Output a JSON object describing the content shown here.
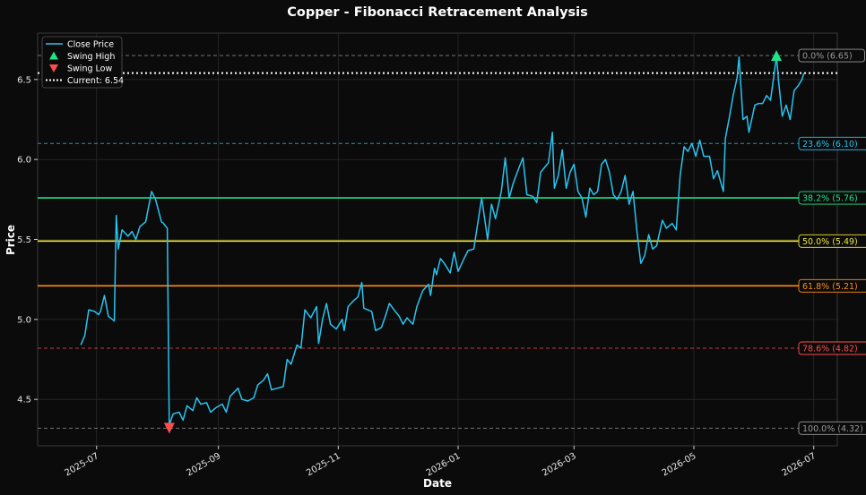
{
  "chart_data": {
    "type": "line",
    "title": "Copper - Fibonacci Retracement Analysis",
    "xlabel": "Date",
    "ylabel": "Price",
    "xlim": [
      "2025-06-01",
      "2026-07-13"
    ],
    "ylim": [
      4.21,
      6.79
    ],
    "x_ticks": [
      "2025-07",
      "2025-09",
      "2025-11",
      "2026-01",
      "2026-03",
      "2026-05",
      "2026-07"
    ],
    "y_ticks": [
      "4.5",
      "5.0",
      "5.5",
      "6.0",
      "6.5"
    ],
    "grid": true,
    "legend_position": "top-left",
    "legend": [
      {
        "label": "Close Price",
        "kind": "line",
        "color": "#29c4f0"
      },
      {
        "label": "Swing High",
        "kind": "triangle-up",
        "color": "#1fe28a"
      },
      {
        "label": "Swing Low",
        "kind": "triangle-down",
        "color": "#ff4d4d"
      },
      {
        "label": "Current: 6.54",
        "kind": "dotted",
        "color": "#ffffff"
      }
    ],
    "series": [
      {
        "name": "Close Price",
        "color": "#29c4f0",
        "points": [
          [
            "2025-06-23",
            4.84
          ],
          [
            "2025-06-25",
            4.9
          ],
          [
            "2025-06-27",
            5.06
          ],
          [
            "2025-06-30",
            5.05
          ],
          [
            "2025-07-02",
            5.03
          ],
          [
            "2025-07-03",
            5.05
          ],
          [
            "2025-07-05",
            5.15
          ],
          [
            "2025-07-07",
            5.02
          ],
          [
            "2025-07-10",
            4.99
          ],
          [
            "2025-07-11",
            5.65
          ],
          [
            "2025-07-12",
            5.44
          ],
          [
            "2025-07-14",
            5.56
          ],
          [
            "2025-07-17",
            5.52
          ],
          [
            "2025-07-19",
            5.55
          ],
          [
            "2025-07-21",
            5.5
          ],
          [
            "2025-07-23",
            5.58
          ],
          [
            "2025-07-26",
            5.61
          ],
          [
            "2025-07-29",
            5.8
          ],
          [
            "2025-07-31",
            5.75
          ],
          [
            "2025-08-03",
            5.61
          ],
          [
            "2025-08-04",
            5.6
          ],
          [
            "2025-08-06",
            5.57
          ],
          [
            "2025-08-07",
            4.34
          ],
          [
            "2025-08-09",
            4.41
          ],
          [
            "2025-08-12",
            4.42
          ],
          [
            "2025-08-14",
            4.37
          ],
          [
            "2025-08-16",
            4.46
          ],
          [
            "2025-08-19",
            4.43
          ],
          [
            "2025-08-21",
            4.51
          ],
          [
            "2025-08-23",
            4.47
          ],
          [
            "2025-08-26",
            4.48
          ],
          [
            "2025-08-28",
            4.42
          ],
          [
            "2025-08-31",
            4.45
          ],
          [
            "2025-09-03",
            4.47
          ],
          [
            "2025-09-05",
            4.42
          ],
          [
            "2025-09-07",
            4.52
          ],
          [
            "2025-09-11",
            4.57
          ],
          [
            "2025-09-13",
            4.5
          ],
          [
            "2025-09-16",
            4.49
          ],
          [
            "2025-09-19",
            4.51
          ],
          [
            "2025-09-21",
            4.59
          ],
          [
            "2025-09-24",
            4.62
          ],
          [
            "2025-09-26",
            4.66
          ],
          [
            "2025-09-28",
            4.56
          ],
          [
            "2025-10-01",
            4.57
          ],
          [
            "2025-10-04",
            4.58
          ],
          [
            "2025-10-06",
            4.75
          ],
          [
            "2025-10-08",
            4.72
          ],
          [
            "2025-10-11",
            4.84
          ],
          [
            "2025-10-13",
            4.82
          ],
          [
            "2025-10-15",
            5.06
          ],
          [
            "2025-10-18",
            5.01
          ],
          [
            "2025-10-21",
            5.08
          ],
          [
            "2025-10-22",
            4.85
          ],
          [
            "2025-10-24",
            5.0
          ],
          [
            "2025-10-26",
            5.1
          ],
          [
            "2025-10-28",
            4.97
          ],
          [
            "2025-10-31",
            4.94
          ],
          [
            "2025-11-03",
            5.0
          ],
          [
            "2025-11-04",
            4.93
          ],
          [
            "2025-11-06",
            5.08
          ],
          [
            "2025-11-09",
            5.12
          ],
          [
            "2025-11-11",
            5.14
          ],
          [
            "2025-11-13",
            5.23
          ],
          [
            "2025-11-14",
            5.07
          ],
          [
            "2025-11-18",
            5.05
          ],
          [
            "2025-11-20",
            4.93
          ],
          [
            "2025-11-23",
            4.95
          ],
          [
            "2025-11-25",
            5.02
          ],
          [
            "2025-11-27",
            5.1
          ],
          [
            "2025-11-30",
            5.05
          ],
          [
            "2025-12-02",
            5.02
          ],
          [
            "2025-12-04",
            4.97
          ],
          [
            "2025-12-06",
            5.01
          ],
          [
            "2025-12-09",
            4.97
          ],
          [
            "2025-12-11",
            5.08
          ],
          [
            "2025-12-14",
            5.18
          ],
          [
            "2025-12-17",
            5.22
          ],
          [
            "2025-12-18",
            5.15
          ],
          [
            "2025-12-20",
            5.32
          ],
          [
            "2025-12-21",
            5.28
          ],
          [
            "2025-12-23",
            5.38
          ],
          [
            "2025-12-25",
            5.35
          ],
          [
            "2025-12-28",
            5.29
          ],
          [
            "2025-12-30",
            5.42
          ],
          [
            "2026-01-01",
            5.3
          ],
          [
            "2026-01-04",
            5.38
          ],
          [
            "2026-01-06",
            5.43
          ],
          [
            "2026-01-09",
            5.44
          ],
          [
            "2026-01-11",
            5.6
          ],
          [
            "2026-01-13",
            5.76
          ],
          [
            "2026-01-16",
            5.5
          ],
          [
            "2026-01-18",
            5.72
          ],
          [
            "2026-01-20",
            5.63
          ],
          [
            "2026-01-23",
            5.8
          ],
          [
            "2026-01-25",
            6.01
          ],
          [
            "2026-01-27",
            5.76
          ],
          [
            "2026-01-29",
            5.85
          ],
          [
            "2026-02-01",
            5.95
          ],
          [
            "2026-02-03",
            6.01
          ],
          [
            "2026-02-05",
            5.78
          ],
          [
            "2026-02-08",
            5.77
          ],
          [
            "2026-02-10",
            5.73
          ],
          [
            "2026-02-12",
            5.92
          ],
          [
            "2026-02-14",
            5.95
          ],
          [
            "2026-02-16",
            5.98
          ],
          [
            "2026-02-18",
            6.17
          ],
          [
            "2026-02-19",
            5.82
          ],
          [
            "2026-02-21",
            5.9
          ],
          [
            "2026-02-23",
            6.06
          ],
          [
            "2026-02-25",
            5.82
          ],
          [
            "2026-02-27",
            5.92
          ],
          [
            "2026-03-01",
            5.97
          ],
          [
            "2026-03-03",
            5.8
          ],
          [
            "2026-03-05",
            5.76
          ],
          [
            "2026-03-07",
            5.64
          ],
          [
            "2026-03-09",
            5.82
          ],
          [
            "2026-03-11",
            5.78
          ],
          [
            "2026-03-13",
            5.8
          ],
          [
            "2026-03-15",
            5.97
          ],
          [
            "2026-03-17",
            6.0
          ],
          [
            "2026-03-19",
            5.92
          ],
          [
            "2026-03-21",
            5.78
          ],
          [
            "2026-03-23",
            5.75
          ],
          [
            "2026-03-25",
            5.8
          ],
          [
            "2026-03-27",
            5.9
          ],
          [
            "2026-03-29",
            5.72
          ],
          [
            "2026-03-31",
            5.8
          ],
          [
            "2026-04-02",
            5.55
          ],
          [
            "2026-04-04",
            5.35
          ],
          [
            "2026-04-06",
            5.4
          ],
          [
            "2026-04-08",
            5.53
          ],
          [
            "2026-04-10",
            5.44
          ],
          [
            "2026-04-12",
            5.46
          ],
          [
            "2026-04-15",
            5.62
          ],
          [
            "2026-04-17",
            5.57
          ],
          [
            "2026-04-20",
            5.6
          ],
          [
            "2026-04-22",
            5.56
          ],
          [
            "2026-04-24",
            5.9
          ],
          [
            "2026-04-26",
            6.08
          ],
          [
            "2026-04-28",
            6.05
          ],
          [
            "2026-04-30",
            6.1
          ],
          [
            "2026-05-02",
            6.02
          ],
          [
            "2026-05-04",
            6.12
          ],
          [
            "2026-05-06",
            6.02
          ],
          [
            "2026-05-09",
            6.02
          ],
          [
            "2026-05-11",
            5.88
          ],
          [
            "2026-05-13",
            5.93
          ],
          [
            "2026-05-16",
            5.8
          ],
          [
            "2026-05-17",
            6.13
          ],
          [
            "2026-05-19",
            6.26
          ],
          [
            "2026-05-21",
            6.4
          ],
          [
            "2026-05-23",
            6.51
          ],
          [
            "2026-05-24",
            6.64
          ],
          [
            "2026-05-26",
            6.25
          ],
          [
            "2026-05-28",
            6.27
          ],
          [
            "2026-05-29",
            6.17
          ],
          [
            "2026-06-01",
            6.34
          ],
          [
            "2026-06-03",
            6.35
          ],
          [
            "2026-06-05",
            6.35
          ],
          [
            "2026-06-07",
            6.4
          ],
          [
            "2026-06-09",
            6.37
          ],
          [
            "2026-06-11",
            6.55
          ],
          [
            "2026-06-12",
            6.65
          ],
          [
            "2026-06-13",
            6.5
          ],
          [
            "2026-06-15",
            6.27
          ],
          [
            "2026-06-17",
            6.34
          ],
          [
            "2026-06-19",
            6.25
          ],
          [
            "2026-06-21",
            6.43
          ],
          [
            "2026-06-23",
            6.46
          ],
          [
            "2026-06-25",
            6.5
          ],
          [
            "2026-06-26",
            6.54
          ]
        ]
      }
    ],
    "markers": [
      {
        "name": "Swing High",
        "shape": "triangle-up",
        "date": "2026-06-12",
        "value": 6.65,
        "color": "#1fe28a"
      },
      {
        "name": "Swing Low",
        "shape": "triangle-down",
        "date": "2025-08-07",
        "value": 4.32,
        "color": "#ff4d4d"
      }
    ],
    "current": {
      "label": "Current: 6.54",
      "value": 6.54,
      "color": "#ffffff"
    },
    "fib_levels": [
      {
        "label": "0.0% (6.65)",
        "value": 6.65,
        "color": "#9a9a9a",
        "style": "dashed"
      },
      {
        "label": "23.6% (6.10)",
        "value": 6.1,
        "color": "#29c4f0",
        "style": "dashed"
      },
      {
        "label": "38.2% (5.76)",
        "value": 5.76,
        "color": "#1fe28a",
        "style": "solid"
      },
      {
        "label": "50.0% (5.49)",
        "value": 5.49,
        "color": "#f2e83d",
        "style": "solid"
      },
      {
        "label": "61.8% (5.21)",
        "value": 5.21,
        "color": "#ff8c1a",
        "style": "solid"
      },
      {
        "label": "78.6% (4.82)",
        "value": 4.82,
        "color": "#ff4d4d",
        "style": "dashed"
      },
      {
        "label": "100.0% (4.32)",
        "value": 4.32,
        "color": "#9a9a9a",
        "style": "dashed"
      }
    ]
  }
}
